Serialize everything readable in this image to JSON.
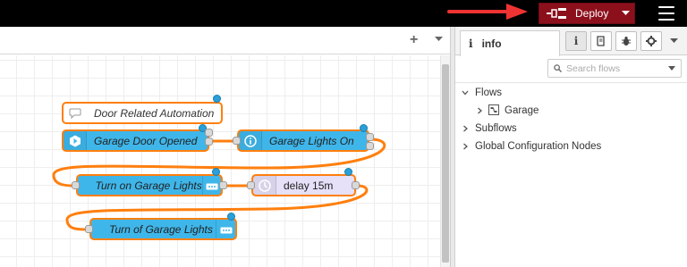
{
  "header": {
    "deploy_label": "Deploy",
    "accent_color": "#8c101c"
  },
  "workspace": {
    "add_icon": "plus-icon",
    "menu_icon": "caret-down-icon"
  },
  "flow": {
    "nodes": [
      {
        "id": "comment",
        "label": "Door Related Automation",
        "type": "comment",
        "icon": "comment-icon"
      },
      {
        "id": "trigger",
        "label": "Garage Door Opened",
        "type": "event",
        "icon": "hexagon-icon"
      },
      {
        "id": "current-state",
        "label": "Garage Lights On",
        "type": "state",
        "icon": "info-icon"
      },
      {
        "id": "turn-on",
        "label": "Turn on Garage Lights",
        "type": "service",
        "icon": "remote-icon"
      },
      {
        "id": "delay",
        "label": "delay 15m",
        "type": "delay",
        "icon": "timer-icon"
      },
      {
        "id": "turn-off",
        "label": "Turn of Garage Lights",
        "type": "service",
        "icon": "remote-icon"
      }
    ]
  },
  "sidebar": {
    "active_tab": "info",
    "search_placeholder": "Search flows",
    "tree": [
      {
        "label": "Flows",
        "expanded": true
      },
      {
        "label": "Garage",
        "child": true
      },
      {
        "label": "Subflows",
        "expanded": false
      },
      {
        "label": "Global Configuration Nodes",
        "expanded": false
      }
    ]
  }
}
